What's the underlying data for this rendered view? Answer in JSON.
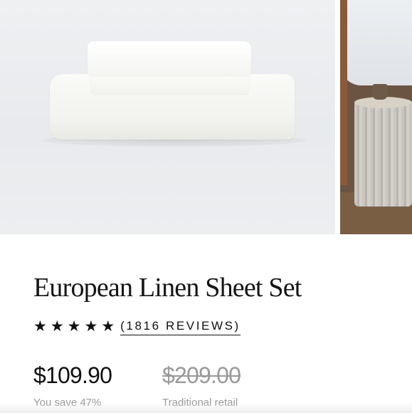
{
  "product": {
    "title": "European Linen Sheet Set",
    "rating": {
      "stars": 5,
      "reviews_label": "(1816 REVIEWS)"
    },
    "price": "$109.90",
    "retail_price": "$209.00",
    "savings_note": "You save 47%",
    "retail_note": "Traditional retail"
  },
  "gallery": {
    "images": [
      {
        "name": "stacked-linen-sheets"
      },
      {
        "name": "bedroom-nightstand"
      }
    ]
  },
  "icons": {
    "star": "star-icon"
  },
  "colors": {
    "text": "#111111",
    "muted": "#9a9a9a"
  }
}
